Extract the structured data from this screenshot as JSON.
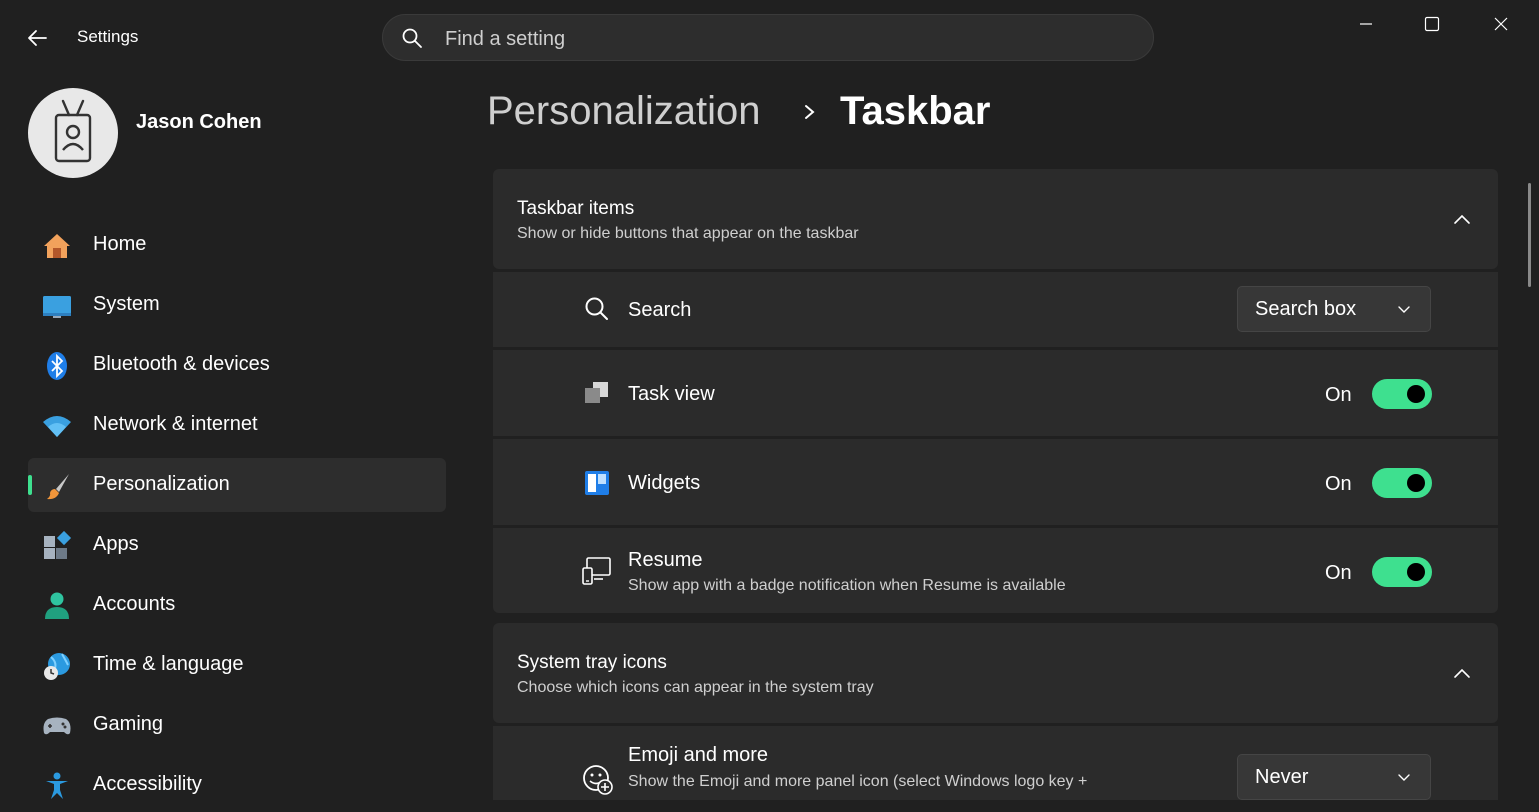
{
  "window": {
    "title": "Settings",
    "controls": [
      "minimize",
      "maximize",
      "close"
    ]
  },
  "search": {
    "placeholder": "Find a setting"
  },
  "user": {
    "name": "Jason Cohen"
  },
  "sidebar": {
    "items": [
      {
        "label": "Home",
        "icon": "home-icon"
      },
      {
        "label": "System",
        "icon": "system-icon"
      },
      {
        "label": "Bluetooth & devices",
        "icon": "bluetooth-icon"
      },
      {
        "label": "Network & internet",
        "icon": "wifi-icon"
      },
      {
        "label": "Personalization",
        "icon": "brush-icon",
        "selected": true
      },
      {
        "label": "Apps",
        "icon": "apps-icon"
      },
      {
        "label": "Accounts",
        "icon": "accounts-icon"
      },
      {
        "label": "Time & language",
        "icon": "globe-clock-icon"
      },
      {
        "label": "Gaming",
        "icon": "gamepad-icon"
      },
      {
        "label": "Accessibility",
        "icon": "accessibility-icon"
      }
    ]
  },
  "breadcrumb": {
    "parent": "Personalization",
    "current": "Taskbar"
  },
  "sections": {
    "taskbar_items": {
      "title": "Taskbar items",
      "subtitle": "Show or hide buttons that appear on the taskbar",
      "rows": {
        "search": {
          "label": "Search",
          "value": "Search box",
          "icon": "search-icon"
        },
        "task_view": {
          "label": "Task view",
          "state": "On",
          "icon": "task-view-icon"
        },
        "widgets": {
          "label": "Widgets",
          "state": "On",
          "icon": "widgets-icon"
        },
        "resume": {
          "label": "Resume",
          "sub": "Show app with a badge notification when Resume is available",
          "state": "On",
          "icon": "resume-icon"
        }
      }
    },
    "system_tray": {
      "title": "System tray icons",
      "subtitle": "Choose which icons can appear in the system tray",
      "rows": {
        "emoji": {
          "label": "Emoji and more",
          "sub": "Show the Emoji and more panel icon (select Windows logo key +",
          "value": "Never",
          "icon": "emoji-icon"
        }
      }
    }
  },
  "colors": {
    "accent": "#3ee08f",
    "background": "#202020",
    "card": "#2b2b2b"
  }
}
